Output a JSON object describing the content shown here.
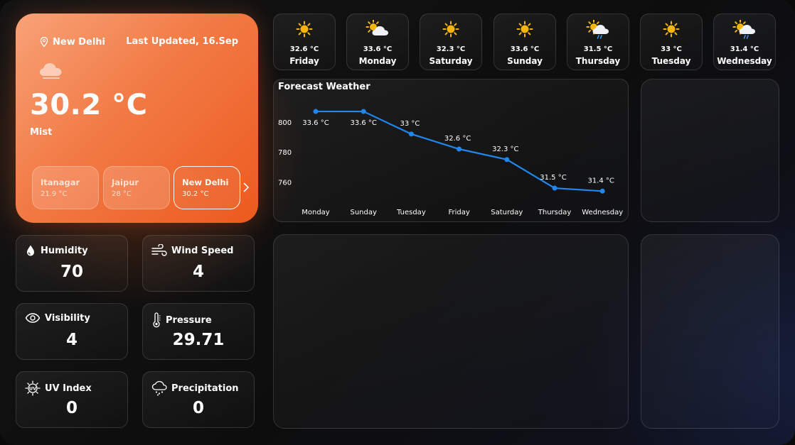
{
  "current": {
    "city": "New Delhi",
    "last_updated": "Last Updated, 16.Sep",
    "temperature": "30.2 °C",
    "condition": "Mist"
  },
  "cities": [
    {
      "name": "Itanagar",
      "temp": "21.9 °C",
      "active": false
    },
    {
      "name": "Jaipur",
      "temp": "28 °C",
      "active": false
    },
    {
      "name": "New Delhi",
      "temp": "30.2 °C",
      "active": true
    }
  ],
  "stats": {
    "humidity": {
      "label": "Humidity",
      "value": "70"
    },
    "wind_speed": {
      "label": "Wind Speed",
      "value": "4"
    },
    "visibility": {
      "label": "Visibility",
      "value": "4"
    },
    "pressure": {
      "label": "Pressure",
      "value": "29.71"
    },
    "uv_index": {
      "label": "UV Index",
      "value": "0"
    },
    "precipitation": {
      "label": "Precipitation",
      "value": "0"
    }
  },
  "forecast_cards": [
    {
      "temp": "32.6 °C",
      "day": "Friday",
      "icon": "sun-icon"
    },
    {
      "temp": "33.6 °C",
      "day": "Monday",
      "icon": "partly-cloudy-icon"
    },
    {
      "temp": "32.3 °C",
      "day": "Saturday",
      "icon": "sun-icon"
    },
    {
      "temp": "33.6 °C",
      "day": "Sunday",
      "icon": "sun-icon"
    },
    {
      "temp": "31.5 °C",
      "day": "Thursday",
      "icon": "patchy-rain-icon"
    },
    {
      "temp": "33 °C",
      "day": "Tuesday",
      "icon": "sun-icon"
    },
    {
      "temp": "31.4 °C",
      "day": "Wednesday",
      "icon": "patchy-rain-icon"
    }
  ],
  "chart_data": {
    "type": "line",
    "title": "Forecast Weather",
    "categories": [
      "Monday",
      "Sunday",
      "Tuesday",
      "Friday",
      "Saturday",
      "Thursday",
      "Wednesday"
    ],
    "values": [
      807,
      807,
      792,
      782,
      775,
      756,
      754
    ],
    "data_labels": [
      "33.6 °C",
      "33.6 °C",
      "33 °C",
      "32.6 °C",
      "32.3 °C",
      "31.5 °C",
      "31.4 °C"
    ],
    "yticks": [
      760,
      780,
      800
    ],
    "ylim": [
      748,
      816
    ],
    "grid": false,
    "color": "#1e88f0"
  },
  "colors": {
    "accent": "#ec5a1e",
    "sun": "#f5b50a",
    "line": "#1e88f0"
  }
}
